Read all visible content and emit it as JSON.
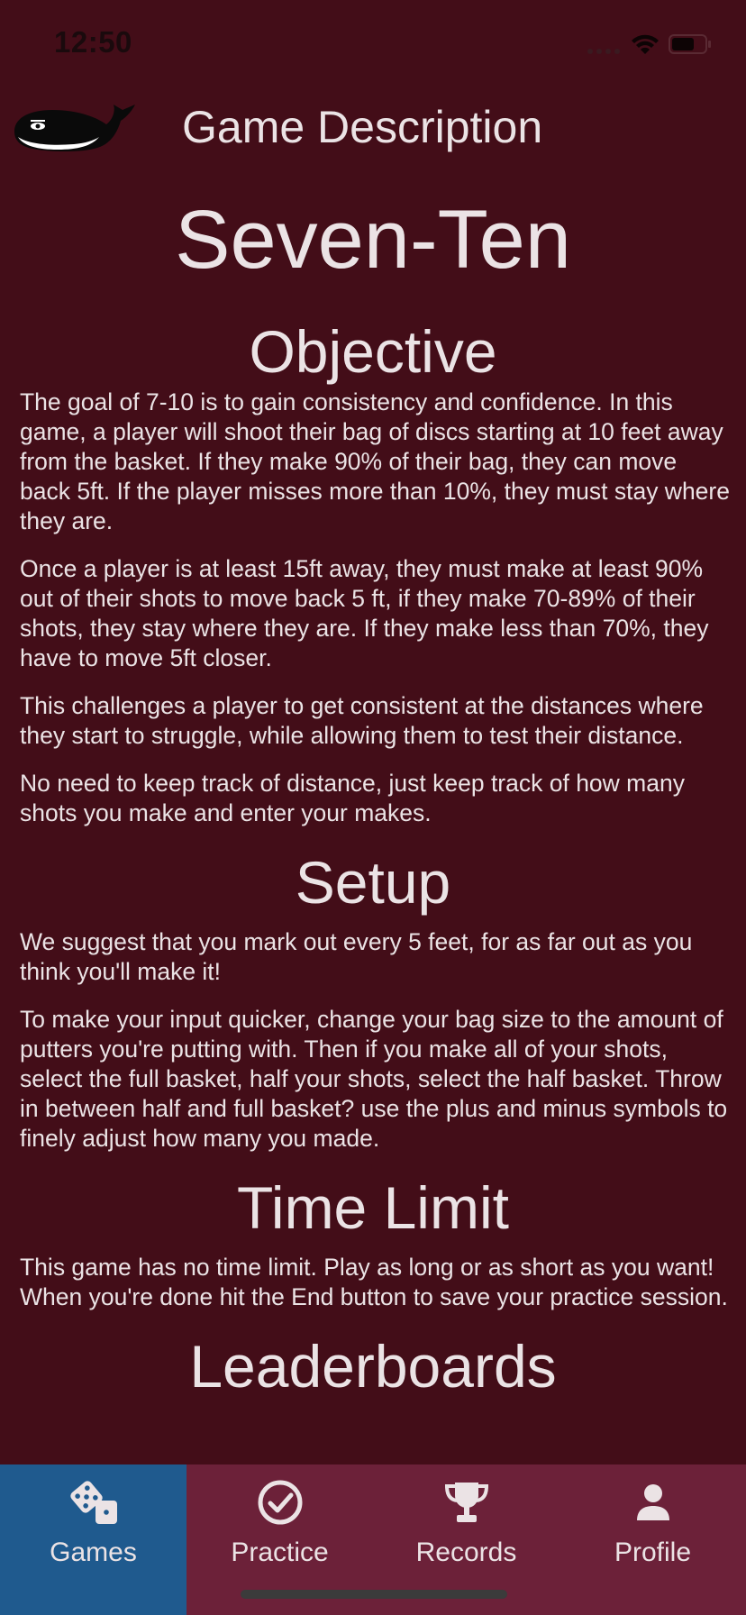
{
  "status_bar": {
    "time": "12:50"
  },
  "header": {
    "title": "Game Description"
  },
  "game": {
    "title": "Seven-Ten"
  },
  "sections": {
    "objective": {
      "heading": "Objective",
      "paragraphs": [
        "The goal of 7-10 is to gain consistency and confidence. In this game, a player will shoot their bag of discs starting at 10 feet away from the basket. If they make 90% of their bag, they can move back 5ft. If the player misses more than 10%, they must stay where they are.",
        "Once a player is at least 15ft away, they must make at least 90% out of their shots to move back 5 ft, if they make 70-89% of their shots, they stay where they are. If they make less than 70%, they have to move 5ft closer.",
        "This challenges a player to get consistent at the distances where they start to struggle, while allowing them to test their distance.",
        "No need to keep track of distance, just keep track of how many shots you make and enter your makes."
      ]
    },
    "setup": {
      "heading": "Setup",
      "paragraphs": [
        "We suggest that you mark out every 5 feet, for as far out as you think you'll make it!",
        "To make your input quicker, change your bag size to the amount of putters you're putting with. Then if you make all of your shots, select the full basket, half your shots, select the half basket. Throw in between half and full basket? use the plus and minus symbols to finely adjust how many you made."
      ]
    },
    "time_limit": {
      "heading": "Time Limit",
      "paragraphs": [
        "This game has no time limit. Play as long or as short as you want! When you're done hit the End button to save your practice session."
      ]
    },
    "leaderboards": {
      "heading": "Leaderboards"
    }
  },
  "tab_bar": {
    "active_color": "#1f5a8e",
    "background_color": "#6c2139",
    "tabs": [
      {
        "label": "Games",
        "icon": "dice-icon"
      },
      {
        "label": "Practice",
        "icon": "check-circle-icon"
      },
      {
        "label": "Records",
        "icon": "trophy-icon"
      },
      {
        "label": "Profile",
        "icon": "person-icon"
      }
    ]
  },
  "colors": {
    "background": "#430d18",
    "text": "#ebe3e5"
  }
}
